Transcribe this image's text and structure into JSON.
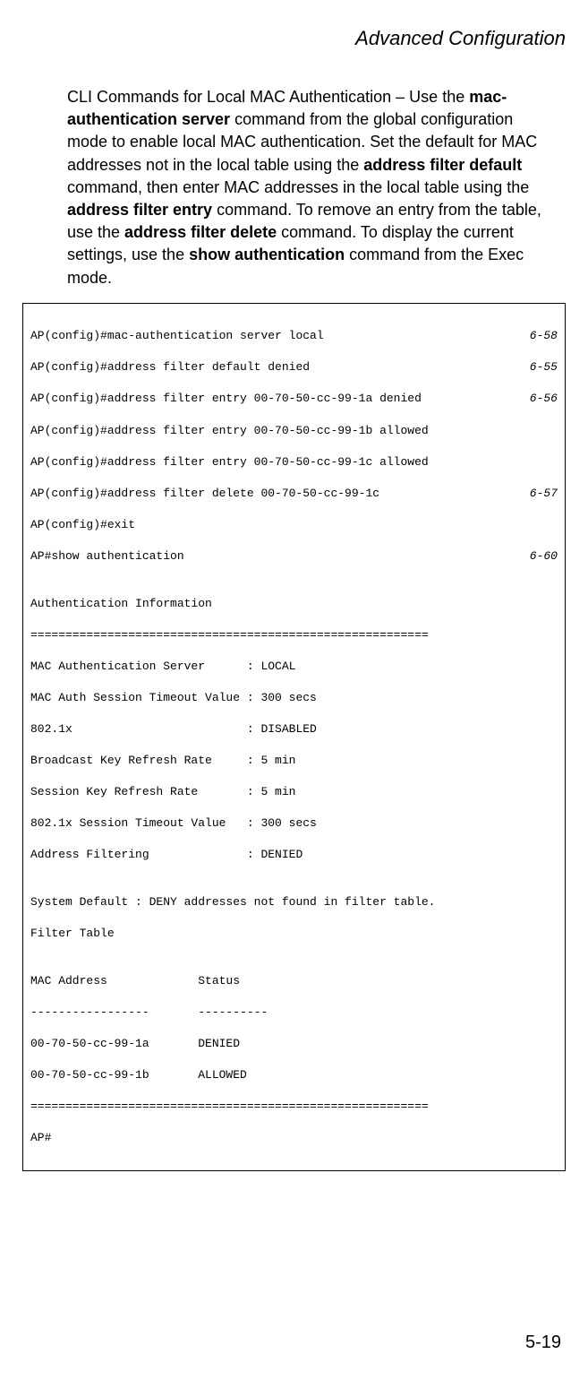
{
  "header": {
    "title": "Advanced Configuration"
  },
  "paragraph": {
    "p1": "CLI Commands for Local MAC Authentication – Use the ",
    "b1": "mac-authentication server",
    "p2": " command from the global configuration mode to enable local MAC authentication. Set the default for MAC addresses not in the local table using the ",
    "b2": "address filter default",
    "p3": " command, then enter MAC addresses in the local table using the ",
    "b3": "address filter entry",
    "p4": " command. To remove an entry from the table, use the ",
    "b4": "address filter delete",
    "p5": " command. To display the current settings, use the ",
    "b5": "show authentication",
    "p6": " command from the Exec mode."
  },
  "cli": {
    "l1cmd": "AP(config)#mac-authentication server local",
    "l1ref": "6-58",
    "l2cmd": "AP(config)#address filter default denied",
    "l2ref": "6-55",
    "l3cmd": "AP(config)#address filter entry 00-70-50-cc-99-1a denied",
    "l3ref": "6-56",
    "l4": "AP(config)#address filter entry 00-70-50-cc-99-1b allowed",
    "l5": "AP(config)#address filter entry 00-70-50-cc-99-1c allowed",
    "l6cmd": "AP(config)#address filter delete 00-70-50-cc-99-1c",
    "l6ref": "6-57",
    "l7": "AP(config)#exit",
    "l8cmd": "AP#show authentication",
    "l8ref": "6-60",
    "l9": "",
    "l10": "Authentication Information",
    "l11": "=========================================================",
    "l12": "MAC Authentication Server      : LOCAL",
    "l13": "MAC Auth Session Timeout Value : 300 secs",
    "l14": "802.1x                         : DISABLED",
    "l15": "Broadcast Key Refresh Rate     : 5 min",
    "l16": "Session Key Refresh Rate       : 5 min",
    "l17": "802.1x Session Timeout Value   : 300 secs",
    "l18": "Address Filtering              : DENIED",
    "l19": "",
    "l20": "System Default : DENY addresses not found in filter table.",
    "l21": "Filter Table",
    "l22": "",
    "l23": "MAC Address             Status",
    "l24": "-----------------       ----------",
    "l25": "00-70-50-cc-99-1a       DENIED",
    "l26": "00-70-50-cc-99-1b       ALLOWED",
    "l27": "=========================================================",
    "l28": "AP#"
  },
  "footer": {
    "page": "5-19"
  }
}
